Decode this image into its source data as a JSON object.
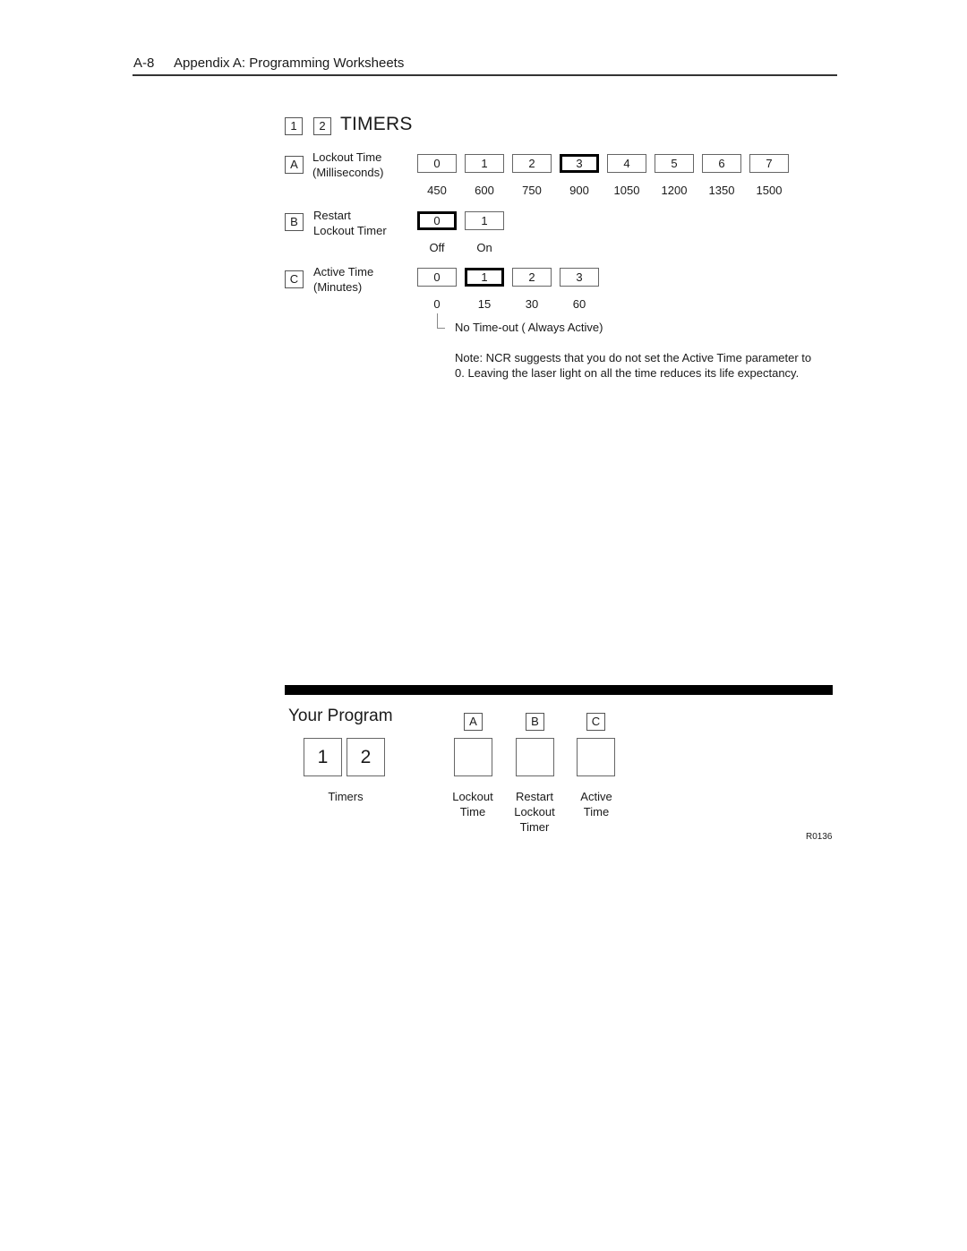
{
  "header": {
    "page_number": "A-8",
    "title": "Appendix A:  Programming Worksheets"
  },
  "section": {
    "code_boxes": [
      "1",
      "2"
    ],
    "title": "TIMERS"
  },
  "parameters": [
    {
      "letter": "A",
      "label_lines": [
        "Lockout Time",
        "(Milliseconds)"
      ],
      "options": [
        "0",
        "1",
        "2",
        "3",
        "4",
        "5",
        "6",
        "7"
      ],
      "values": [
        "450",
        "600",
        "750",
        "900",
        "1050",
        "1200",
        "1350",
        "1500"
      ],
      "selected_index": 3
    },
    {
      "letter": "B",
      "label_lines": [
        "Restart",
        "Lockout Timer"
      ],
      "options": [
        "0",
        "1"
      ],
      "values": [
        "Off",
        "On"
      ],
      "selected_index": 0
    },
    {
      "letter": "C",
      "label_lines": [
        "Active Time",
        "(Minutes)"
      ],
      "options": [
        "0",
        "1",
        "2",
        "3"
      ],
      "values": [
        "0",
        "15",
        "30",
        "60"
      ],
      "selected_index": 1,
      "zero_note": "No Time-out ( Always Active)"
    }
  ],
  "note": "Note:  NCR suggests that you do not set the Active Time parameter to 0. Leaving the laser light on all the time reduces its life expectancy.",
  "your_program": {
    "title": "Your Program",
    "code_digits": [
      "1",
      "2"
    ],
    "code_caption": "Timers",
    "fields": [
      {
        "letter": "A",
        "caption_lines": [
          "Lockout",
          "Time"
        ],
        "value": ""
      },
      {
        "letter": "B",
        "caption_lines": [
          "Restart",
          "Lockout",
          "Timer"
        ],
        "value": ""
      },
      {
        "letter": "C",
        "caption_lines": [
          "Active",
          "Time"
        ],
        "value": ""
      }
    ]
  },
  "figure_ref": "R0136"
}
